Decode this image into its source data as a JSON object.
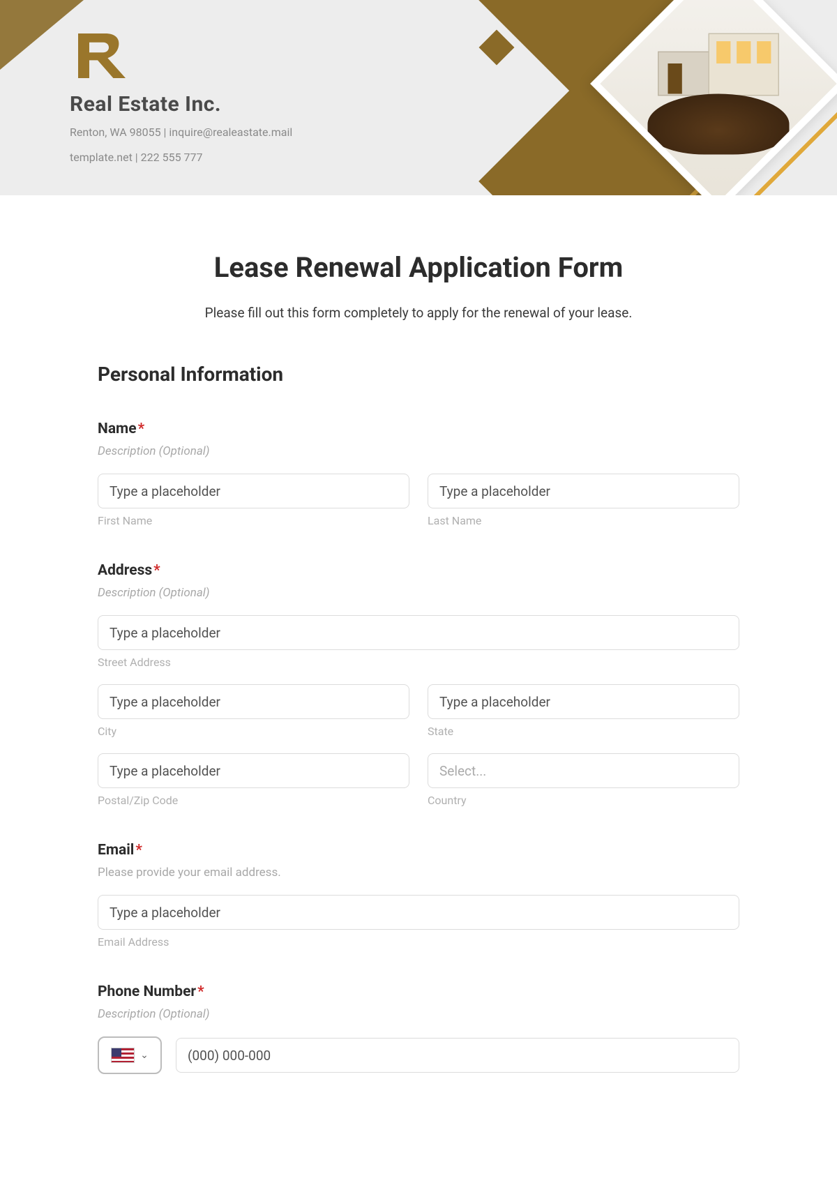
{
  "header": {
    "company_name": "Real Estate Inc.",
    "address_line": "Renton, WA 98055 | inquire@realeastate.mail",
    "contact_line": "template.net | 222 555 777"
  },
  "form": {
    "title": "Lease Renewal Application Form",
    "subtitle": "Please fill out this form completely to apply for the renewal of your lease.",
    "section_personal": "Personal Information",
    "name": {
      "label": "Name",
      "required": "*",
      "desc": "Description (Optional)",
      "first_placeholder": "Type a placeholder",
      "first_sub": "First Name",
      "last_placeholder": "Type a placeholder",
      "last_sub": "Last Name"
    },
    "address": {
      "label": "Address",
      "required": "*",
      "desc": "Description (Optional)",
      "street_placeholder": "Type a placeholder",
      "street_sub": "Street Address",
      "city_placeholder": "Type a placeholder",
      "city_sub": "City",
      "state_placeholder": "Type a placeholder",
      "state_sub": "State",
      "postal_placeholder": "Type a placeholder",
      "postal_sub": "Postal/Zip Code",
      "country_placeholder": "Select...",
      "country_sub": "Country"
    },
    "email": {
      "label": "Email",
      "required": "*",
      "desc": "Please provide your email address.",
      "placeholder": "Type a placeholder",
      "sub": "Email Address"
    },
    "phone": {
      "label": "Phone Number",
      "required": "*",
      "desc": "Description (Optional)",
      "placeholder": "(000) 000-000"
    }
  }
}
